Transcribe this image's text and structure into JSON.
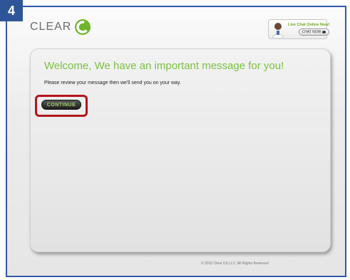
{
  "step_badge": "4",
  "logo": {
    "text": "CLEAR",
    "icon": "clear-logo-icon"
  },
  "chat": {
    "title": "Live Chat Online Now!",
    "button_label": "CHAT NOW",
    "avatar_icon": "agent-avatar-icon",
    "bubble_icon": "speech-bubble-icon"
  },
  "main": {
    "headline": "Welcome, We have an important message for you!",
    "message": "Please review your message then we'll send you on your way.",
    "continue_label": "CONTINUE"
  },
  "footer": {
    "copyright": "© 2010 Clear US LLC, All Rights Reserved"
  },
  "colors": {
    "accent_green": "#7bc043",
    "highlight_red": "#b3161b",
    "frame_blue": "#2f5aa8"
  }
}
